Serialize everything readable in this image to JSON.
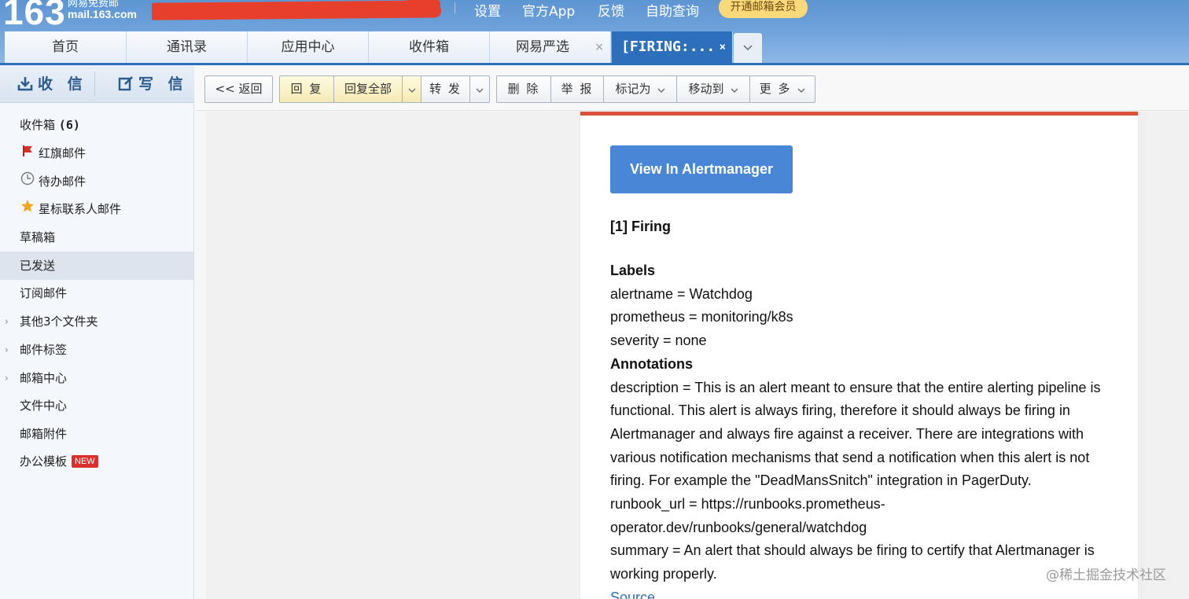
{
  "header": {
    "logo_number": "163",
    "logo_line1": "网易免费邮",
    "logo_line2": "mail.163.com",
    "links": [
      "设置",
      "官方App",
      "反馈",
      "自助查询"
    ],
    "vip_button": "开通邮箱会员"
  },
  "tabs": [
    {
      "label": "首页"
    },
    {
      "label": "通讯录"
    },
    {
      "label": "应用中心"
    },
    {
      "label": "收件箱"
    },
    {
      "label": "网易严选",
      "close": "×"
    },
    {
      "label": "[FIRING:...",
      "close": "×",
      "active": true
    }
  ],
  "tab_more_icon": "chevron-down-icon",
  "sidebar": {
    "receive_label": "收 信",
    "compose_label": "写 信",
    "folders": [
      {
        "label": "收件箱",
        "count": "(6)"
      },
      {
        "label": "红旗邮件",
        "icon": "red-flag-icon"
      },
      {
        "label": "待办邮件",
        "icon": "clock-icon"
      },
      {
        "label": "星标联系人邮件",
        "icon": "star-icon"
      },
      {
        "label": "草稿箱"
      },
      {
        "label": "已发送",
        "selected": true
      },
      {
        "label": "订阅邮件"
      },
      {
        "label": "其他3个文件夹",
        "expandable": true
      },
      {
        "label": "邮件标签",
        "expandable": true
      },
      {
        "label": "邮箱中心",
        "expandable": true
      },
      {
        "label": "文件中心"
      },
      {
        "label": "邮箱附件"
      },
      {
        "label": "办公模板",
        "badge": "NEW"
      }
    ]
  },
  "toolbar": {
    "back": "<< 返回",
    "reply": "回 复",
    "reply_all": "回复全部",
    "forward": "转 发",
    "delete": "删 除",
    "report": "举 报",
    "mark_as": "标记为",
    "move_to": "移动到",
    "more": "更 多"
  },
  "mail": {
    "button_label": "View In Alertmanager",
    "firing_heading": "[1] Firing",
    "labels_heading": "Labels",
    "label_lines": [
      "alertname = Watchdog",
      "prometheus = monitoring/k8s",
      "severity = none"
    ],
    "annotations_heading": "Annotations",
    "annotation_lines": [
      "description = This is an alert meant to ensure that the entire alerting pipeline is",
      "functional. This alert is always firing, therefore it should always be firing in",
      "Alertmanager and always fire against a receiver. There are integrations with",
      "various notification mechanisms that send a notification when this alert is not",
      "firing. For example the \"DeadMansSnitch\" integration in PagerDuty.",
      "runbook_url = https://runbooks.prometheus-",
      "operator.dev/runbooks/general/watchdog",
      "summary = An alert that should always be firing to certify that Alertmanager is",
      "working properly."
    ],
    "source_link": "Source"
  },
  "watermark": "@稀土掘金技术社区",
  "colors": {
    "header_blue": "#6ea2db",
    "active_tab": "#2d6fbb",
    "alert_button": "#4a86d6",
    "card_top_border": "#d9533d",
    "vip_yellow": "#f9d97a"
  }
}
